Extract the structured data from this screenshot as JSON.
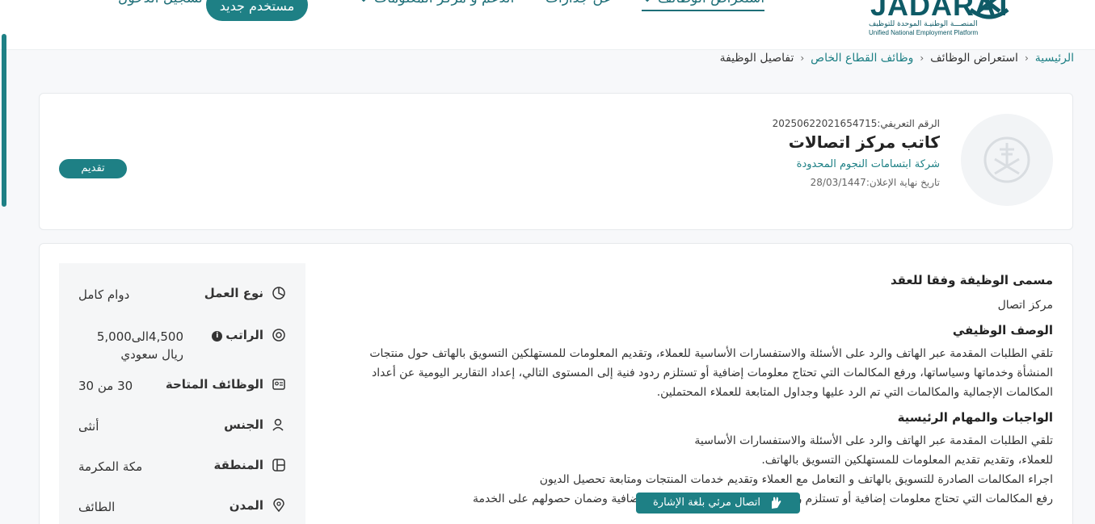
{
  "header": {
    "logo_text": "JADARAT",
    "logo_sub_ar": "المنصـــة الوطنيـة الموحدة للتوظيف",
    "logo_sub_en": "Unified National Employment Platform",
    "nav": {
      "browse_jobs": "استعراض الوظائف",
      "about": "عن جدارات",
      "support": "الدعم و مركز المعلومات",
      "new_user": "مستخدم جديد",
      "login": "تسجيل الدخول"
    }
  },
  "breadcrumb": {
    "home": "الرئيسية",
    "browse": "استعراض الوظائف",
    "private": "وظائف القطاع الخاص",
    "current": "تفاصيل الوظيفة"
  },
  "job": {
    "id_line": "الرقم التعريفي:20250622021654715",
    "title": "كاتب مركز اتصالات",
    "company": "شركة ابتسامات النجوم المحدودة",
    "deadline": "تاريخ نهاية الإعلان:28/03/1447",
    "apply_label": "تقديم"
  },
  "summary": [
    {
      "label": "نوع العمل",
      "value": "دوام كامل",
      "icon": "pie-chart-icon"
    },
    {
      "label": "الراتب",
      "value": "4,500الى5,000 ريال سعودي",
      "icon": "salary-icon"
    },
    {
      "label": "الوظائف المتاحة",
      "value": "30 من 30",
      "icon": "id-card-icon"
    },
    {
      "label": "الجنس",
      "value": "أنثى",
      "icon": "person-icon"
    },
    {
      "label": "المنطقة",
      "value": "مكة المكرمة",
      "icon": "map-icon"
    },
    {
      "label": "المدن",
      "value": "الطائف",
      "icon": "location-pin-icon"
    }
  ],
  "sections": {
    "contract_title_heading": "مسمى الوظيفة وفقا للعقد",
    "contract_title_value": "مركز اتصال",
    "description_heading": "الوصف الوظيفي",
    "description_text": "تلقي الطلبات المقدمة عبر الهاتف والرد على الأسئلة والاستفسارات الأساسية للعملاء، وتقديم المعلومات للمستهلكين التسويق بالهاتف حول منتجات المنشأة وخدماتها وسياساتها، ورفع المكالمات التي تحتاج معلومات إضافية أو تستلزم ردود فنية إلى المستوى التالي، إعداد التقارير اليومية عن أعداد المكالمات الإجمالية والمكالمات التي تم الرد عليها وجداول المتابعة للعملاء المحتملين.",
    "duties_heading": "الواجبات والمهام الرئيسية",
    "duties_1": "تلقي الطلبات المقدمة عبر الهاتف والرد على الأسئلة والاستفسارات الأساسية للعملاء، وتقديم تقديم المعلومات للمستهلكين التسويق بالهاتف.",
    "duties_2": "اجراء المكالمات الصادرة للتسويق بالهاتف و التعامل مع العملاء وتقديم خدمات المنتجات ومتابعة تحصيل الديون",
    "duties_3": "رفع المكالمات التي تحتاج معلومات إضافية أو تستلزم ردود فنية لتلبية احتياجات العملاء الإضافية وضمان حصولهم على الخدمة"
  },
  "sign_language": {
    "label": "اتصال مرئي بلغة الإشارة"
  }
}
